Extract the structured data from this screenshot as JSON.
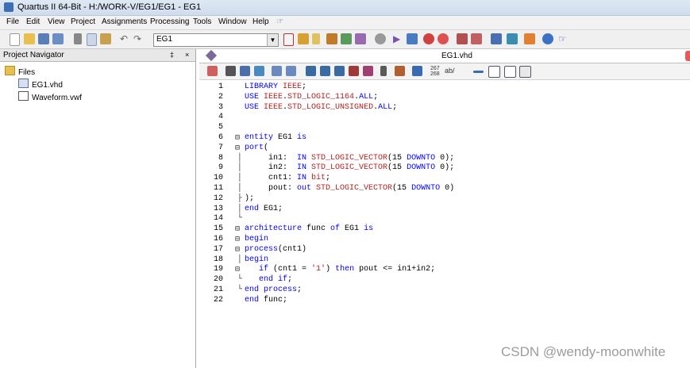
{
  "window": {
    "title": "Quartus II 64-Bit - H:/WORK-V/EG1/EG1 - EG1"
  },
  "menu": [
    "File",
    "Edit",
    "View",
    "Project",
    "Assignments",
    "Processing",
    "Tools",
    "Window",
    "Help"
  ],
  "toolbar": {
    "entity_select": "EG1"
  },
  "navigator": {
    "title": "Project Navigator",
    "controls": [
      "‡",
      "×"
    ],
    "root": "Files",
    "files": [
      "EG1.vhd",
      "Waveform.vwf"
    ]
  },
  "editor": {
    "tab_title": "EG1.vhd",
    "lines": [
      [
        [
          "kw",
          "LIBRARY "
        ],
        [
          "ty",
          "IEEE"
        ],
        [
          "p",
          ";"
        ]
      ],
      [
        [
          "kw",
          "USE "
        ],
        [
          "ty",
          "IEEE"
        ],
        [
          "p",
          "."
        ],
        [
          "ty",
          "STD_LOGIC_1164"
        ],
        [
          "p",
          "."
        ],
        [
          "kw",
          "ALL"
        ],
        [
          "p",
          ";"
        ]
      ],
      [
        [
          "kw",
          "USE "
        ],
        [
          "ty",
          "IEEE"
        ],
        [
          "p",
          "."
        ],
        [
          "ty",
          "STD_LOGIC_UNSIGNED"
        ],
        [
          "p",
          "."
        ],
        [
          "kw",
          "ALL"
        ],
        [
          "p",
          ";"
        ]
      ],
      [],
      [],
      [
        [
          "kw",
          "entity"
        ],
        [
          "p",
          " EG1 "
        ],
        [
          "kw",
          "is"
        ]
      ],
      [
        [
          "kw",
          "port"
        ],
        [
          "p",
          "("
        ]
      ],
      [
        [
          "p",
          "     in1:  "
        ],
        [
          "kw",
          "IN "
        ],
        [
          "ty",
          "STD_LOGIC_VECTOR"
        ],
        [
          "p",
          "(15 "
        ],
        [
          "kw",
          "DOWNTO"
        ],
        [
          "p",
          " 0);"
        ]
      ],
      [
        [
          "p",
          "     in2:  "
        ],
        [
          "kw",
          "IN "
        ],
        [
          "ty",
          "STD_LOGIC_VECTOR"
        ],
        [
          "p",
          "(15 "
        ],
        [
          "kw",
          "DOWNTO"
        ],
        [
          "p",
          " 0);"
        ]
      ],
      [
        [
          "p",
          "     cnt1: "
        ],
        [
          "kw",
          "IN "
        ],
        [
          "ty",
          "bit"
        ],
        [
          "p",
          ";"
        ]
      ],
      [
        [
          "p",
          "     pout: "
        ],
        [
          "kw",
          "out "
        ],
        [
          "ty",
          "STD_LOGIC_VECTOR"
        ],
        [
          "p",
          "(15 "
        ],
        [
          "kw",
          "DOWNTO"
        ],
        [
          "p",
          " 0)"
        ]
      ],
      [
        [
          "p",
          ");"
        ]
      ],
      [
        [
          "kw",
          "end"
        ],
        [
          "p",
          " EG1;"
        ]
      ],
      [],
      [
        [
          "kw",
          "architecture"
        ],
        [
          "p",
          " func "
        ],
        [
          "kw",
          "of"
        ],
        [
          "p",
          " EG1 "
        ],
        [
          "kw",
          "is"
        ]
      ],
      [
        [
          "kw",
          "begin"
        ]
      ],
      [
        [
          "kw",
          "process"
        ],
        [
          "p",
          "(cnt1)"
        ]
      ],
      [
        [
          "kw",
          "begin"
        ]
      ],
      [
        [
          "p",
          "   "
        ],
        [
          "kw",
          "if"
        ],
        [
          "p",
          " (cnt1 = "
        ],
        [
          "ty",
          "'1'"
        ],
        [
          "p",
          ") "
        ],
        [
          "kw",
          "then"
        ],
        [
          "p",
          " pout <= in1+in2;"
        ]
      ],
      [
        [
          "p",
          "   "
        ],
        [
          "kw",
          "end if"
        ],
        [
          "p",
          ";"
        ]
      ],
      [
        [
          "kw",
          "end process"
        ],
        [
          "p",
          ";"
        ]
      ],
      [
        [
          "kw",
          "end"
        ],
        [
          "p",
          " func;"
        ]
      ]
    ]
  },
  "watermark": "CSDN @wendy-moonwhite"
}
